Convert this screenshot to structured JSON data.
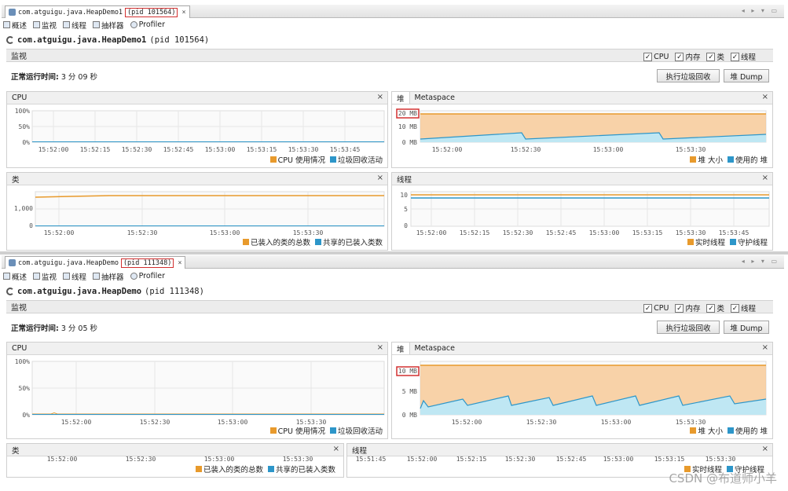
{
  "colors": {
    "cpu": "#e89a2c",
    "gc": "#2d96c9",
    "heap_fill": "#f7c48c",
    "used_fill": "#bfe7f3",
    "grid": "#e6e6e6",
    "highlight": "#d23030"
  },
  "app1": {
    "tab_name": "com.atguigu.java.HeapDemo1",
    "tab_pid": "(pid 101564)",
    "close": "×",
    "subtabs": [
      "概述",
      "监视",
      "线程",
      "抽样器",
      "Profiler"
    ],
    "title_name": "com.atguigu.java.HeapDemo1",
    "title_pid": "(pid 101564)",
    "section": "监视",
    "checks": [
      "CPU",
      "内存",
      "类",
      "线程"
    ],
    "uptime_label": "正常运行时间:",
    "uptime_value": "3 分 09 秒",
    "gc_button": "执行垃圾回收",
    "dump_button": "堆 Dump",
    "cpu": {
      "title": "CPU",
      "y_ticks": [
        "100%",
        "50%",
        "0%"
      ],
      "x_ticks": [
        "15:52:00",
        "15:52:15",
        "15:52:30",
        "15:52:45",
        "15:53:00",
        "15:53:15",
        "15:53:30",
        "15:53:45"
      ],
      "legend": [
        "CPU 使用情况",
        "垃圾回收活动"
      ]
    },
    "heap": {
      "tab1": "堆",
      "tab2": "Metaspace",
      "y_ticks": [
        "20 MB",
        "10 MB",
        "0 MB"
      ],
      "x_ticks": [
        "15:52:00",
        "15:52:30",
        "15:53:00",
        "15:53:30"
      ],
      "legend": [
        "堆 大小",
        "使用的 堆"
      ]
    },
    "classes": {
      "title": "类",
      "y_ticks": [
        "1,000",
        "0"
      ],
      "x_ticks": [
        "15:52:00",
        "15:52:30",
        "15:53:00",
        "15:53:30"
      ],
      "legend": [
        "已装入的类的总数",
        "共享的已装入类数"
      ]
    },
    "threads": {
      "title": "线程",
      "y_ticks": [
        "10",
        "5",
        "0"
      ],
      "x_ticks": [
        "15:52:00",
        "15:52:15",
        "15:52:30",
        "15:52:45",
        "15:53:00",
        "15:53:15",
        "15:53:30",
        "15:53:45"
      ],
      "legend": [
        "实时线程",
        "守护线程"
      ]
    }
  },
  "app2": {
    "tab_name": "com.atguigu.java.HeapDemo",
    "tab_pid": "(pid 111348)",
    "close": "×",
    "subtabs": [
      "概述",
      "监视",
      "线程",
      "抽样器",
      "Profiler"
    ],
    "title_name": "com.atguigu.java.HeapDemo",
    "title_pid": "(pid 111348)",
    "section": "监视",
    "checks": [
      "CPU",
      "内存",
      "类",
      "线程"
    ],
    "uptime_label": "正常运行时间:",
    "uptime_value": "3 分 05 秒",
    "gc_button": "执行垃圾回收",
    "dump_button": "堆 Dump",
    "cpu": {
      "title": "CPU",
      "y_ticks": [
        "100%",
        "50%",
        "0%"
      ],
      "x_ticks": [
        "15:52:00",
        "15:52:30",
        "15:53:00",
        "15:53:30"
      ],
      "legend": [
        "CPU 使用情况",
        "垃圾回收活动"
      ]
    },
    "heap": {
      "tab1": "堆",
      "tab2": "Metaspace",
      "y_ticks": [
        "10 MB",
        "5 MB",
        "0 MB"
      ],
      "x_ticks": [
        "15:52:00",
        "15:52:30",
        "15:53:00",
        "15:53:30"
      ],
      "legend": [
        "堆 大小",
        "使用的 堆"
      ]
    },
    "classes": {
      "title": "类",
      "x_ticks": [
        "15:52:00",
        "15:52:30",
        "15:53:00",
        "15:53:30"
      ],
      "legend": [
        "已装入的类的总数",
        "共享的已装入类数"
      ]
    },
    "threads": {
      "title": "线程",
      "x_ticks": [
        "15:51:45",
        "15:52:00",
        "15:52:15",
        "15:52:30",
        "15:52:45",
        "15:53:00",
        "15:53:15",
        "15:53:30"
      ],
      "legend": [
        "实时线程",
        "守护线程"
      ]
    }
  },
  "watermark": "CSDN @布道师小羊",
  "chart_data": [
    {
      "type": "line",
      "title": "CPU",
      "series": [
        {
          "name": "CPU 使用情况",
          "values": [
            0,
            0,
            0,
            0,
            0,
            0,
            0,
            0
          ]
        },
        {
          "name": "垃圾回收活动",
          "values": [
            0,
            0,
            0,
            0,
            0,
            0,
            0,
            0
          ]
        }
      ],
      "ylim": [
        0,
        100
      ]
    },
    {
      "type": "area",
      "title": "堆",
      "series": [
        {
          "name": "堆 大小",
          "values": [
            19,
            19,
            19,
            19,
            19,
            19,
            19,
            19,
            19
          ]
        },
        {
          "name": "使用的 堆",
          "values": [
            2,
            4,
            6,
            7,
            2,
            4,
            6,
            2,
            5
          ]
        }
      ],
      "ylim": [
        0,
        20
      ]
    },
    {
      "type": "line",
      "title": "类",
      "series": [
        {
          "name": "已装入的类的总数",
          "values": [
            1500,
            1530,
            1545,
            1550,
            1550,
            1550,
            1550,
            1550
          ]
        },
        {
          "name": "共享的已装入类数",
          "values": [
            0,
            0,
            0,
            0,
            0,
            0,
            0,
            0
          ]
        }
      ],
      "ylim": [
        0,
        2000
      ]
    },
    {
      "type": "line",
      "title": "线程",
      "series": [
        {
          "name": "实时线程",
          "values": [
            10,
            10,
            10,
            10,
            10,
            10,
            10,
            10
          ]
        },
        {
          "name": "守护线程",
          "values": [
            9,
            9,
            9,
            9,
            9,
            9,
            9,
            9
          ]
        }
      ],
      "ylim": [
        0,
        11
      ]
    },
    {
      "type": "area",
      "title": "堆",
      "series": [
        {
          "name": "堆 大小",
          "values": [
            10,
            10,
            10,
            10,
            10,
            10,
            10,
            10
          ]
        },
        {
          "name": "使用的 堆",
          "values": [
            1,
            3,
            1.5,
            4,
            1.5,
            4,
            1.5,
            3
          ]
        }
      ],
      "ylim": [
        0,
        10
      ]
    }
  ]
}
